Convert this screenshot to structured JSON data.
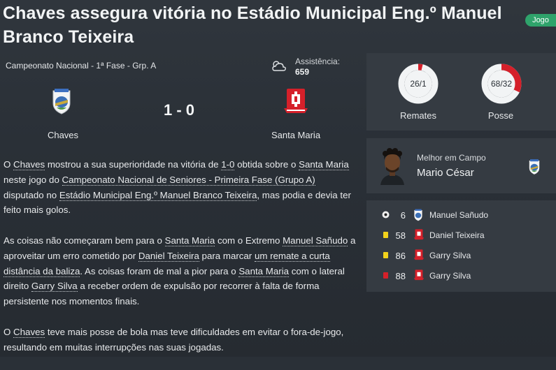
{
  "headline": "Chaves assegura vitória no Estádio Municipal Eng.º Manuel Branco Teixeira",
  "badge": "Jogo",
  "competition": "Campeonato Nacional - 1ª Fase - Grp. A",
  "attendance": {
    "label": "Assistência:",
    "value": "659"
  },
  "match": {
    "home": "Chaves",
    "away": "Santa Maria",
    "score": "1 - 0"
  },
  "stats": [
    {
      "label": "Remates",
      "value": "26/1",
      "fraction_away": 0.037
    },
    {
      "label": "Posse",
      "value": "68/32",
      "fraction_away": 0.32
    }
  ],
  "motm": {
    "label": "Melhor em Campo",
    "name": "Mario César"
  },
  "events": [
    {
      "type": "goal-icon",
      "minute": "6",
      "team": "home",
      "player": "Manuel Sañudo"
    },
    {
      "type": "yellow-card-icon",
      "minute": "58",
      "team": "away",
      "player": "Daniel Teixeira"
    },
    {
      "type": "yellow-card-icon",
      "minute": "86",
      "team": "away",
      "player": "Garry Silva"
    },
    {
      "type": "red-card-icon",
      "minute": "88",
      "team": "away",
      "player": "Garry Silva"
    }
  ],
  "report": {
    "p1": [
      "O ",
      "Chaves",
      " mostrou a sua superioridade na vitória de ",
      "1-0",
      " obtida sobre o ",
      "Santa Maria",
      " neste jogo do ",
      "Campeonato Nacional de Seniores - Primeira Fase (Grupo A)",
      " disputado no ",
      "Estádio Municipal Eng.º Manuel Branco Teixeira",
      ", mas podia e devia ter feito mais golos."
    ],
    "p2": [
      "As coisas não começaram bem para o ",
      "Santa Maria",
      " com o Extremo ",
      "Manuel Sañudo",
      " a aproveitar um erro cometido por ",
      "Daniel Teixeira",
      " para marcar ",
      "um remate a curta distância da baliza",
      ". As coisas foram de mal a pior para o ",
      "Santa Maria",
      " com o lateral direito ",
      "Garry Silva",
      " a receber ordem de expulsão por recorrer à falta de forma persistente nos momentos finais."
    ],
    "p3": [
      "O ",
      "Chaves",
      " teve mais posse de bola mas teve dificuldades em evitar o fora-de-jogo, resultando em muitas interrupções nas suas jogadas."
    ]
  },
  "colors": {
    "accent_red": "#d5202a",
    "badge_green": "#2fa36b",
    "panel": "#353b42"
  }
}
